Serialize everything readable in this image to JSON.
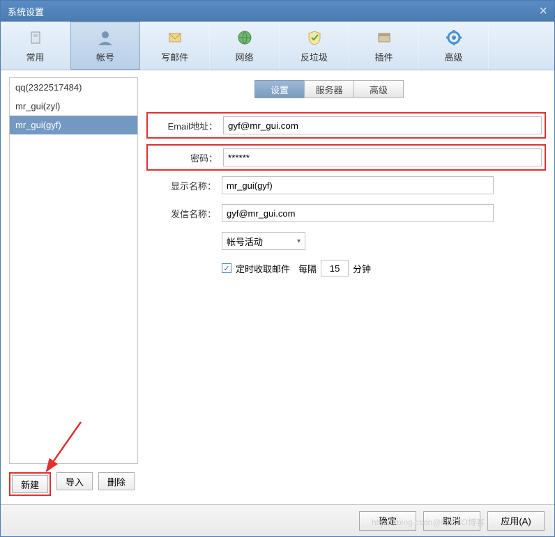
{
  "titlebar": {
    "title": "系统设置"
  },
  "toolbar": {
    "items": [
      {
        "label": "常用"
      },
      {
        "label": "帐号"
      },
      {
        "label": "写邮件"
      },
      {
        "label": "网络"
      },
      {
        "label": "反垃圾"
      },
      {
        "label": "插件"
      },
      {
        "label": "高级"
      }
    ]
  },
  "accounts": {
    "items": [
      {
        "label": "qq(2322517484)"
      },
      {
        "label": "mr_gui(zyl)"
      },
      {
        "label": "mr_gui(gyf)"
      }
    ],
    "buttons": {
      "new": "新建",
      "import": "导入",
      "delete": "删除"
    }
  },
  "tabs": {
    "settings": "设置",
    "server": "服务器",
    "advanced": "高级"
  },
  "form": {
    "email_label": "Email地址：",
    "email_value": "gyf@mr_gui.com",
    "password_label": "密码：",
    "password_value": "******",
    "display_label": "显示名称：",
    "display_value": "mr_gui(gyf)",
    "sender_label": "发信名称：",
    "sender_value": "gyf@mr_gui.com",
    "status_label": "帐号活动",
    "scheduled_label": "定时收取邮件",
    "interval_label": "每隔",
    "interval_value": "15",
    "minutes_label": "分钟"
  },
  "footer": {
    "ok": "确定",
    "cancel": "取消",
    "apply": "应用(A)"
  },
  "watermark": "https://blog.csdn@51CTO博客"
}
